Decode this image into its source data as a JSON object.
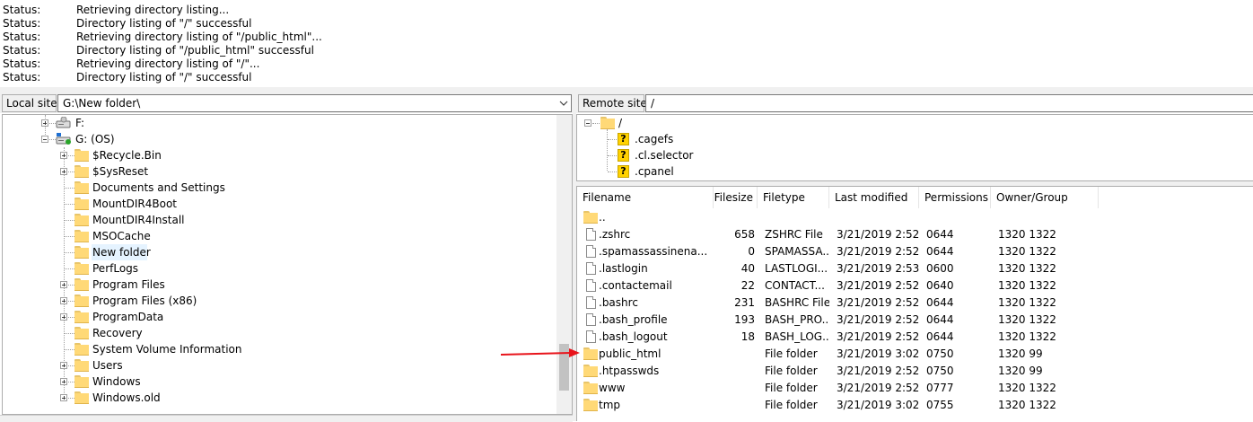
{
  "status_log": [
    {
      "label": "Status:",
      "message": "Retrieving directory listing..."
    },
    {
      "label": "Status:",
      "message": "Directory listing of \"/\" successful"
    },
    {
      "label": "Status:",
      "message": "Retrieving directory listing of \"/public_html\"..."
    },
    {
      "label": "Status:",
      "message": "Directory listing of \"/public_html\" successful"
    },
    {
      "label": "Status:",
      "message": "Retrieving directory listing of \"/\"..."
    },
    {
      "label": "Status:",
      "message": "Directory listing of \"/\" successful"
    }
  ],
  "local": {
    "site_label": "Local site:",
    "path": "G:\\New folder\\",
    "tree": [
      {
        "label": "F:",
        "type": "drive",
        "expander": "plus"
      },
      {
        "label": "G: (OS)",
        "type": "drive",
        "expander": "minus"
      },
      {
        "label": "$Recycle.Bin",
        "type": "folder",
        "expander": "plus"
      },
      {
        "label": "$SysReset",
        "type": "folder",
        "expander": "plus"
      },
      {
        "label": "Documents and Settings",
        "type": "folder",
        "expander": "none"
      },
      {
        "label": "MountDIR4Boot",
        "type": "folder",
        "expander": "none"
      },
      {
        "label": "MountDIR4Install",
        "type": "folder",
        "expander": "none"
      },
      {
        "label": "MSOCache",
        "type": "folder",
        "expander": "none"
      },
      {
        "label": "New folder",
        "type": "folder",
        "expander": "none",
        "selected": true
      },
      {
        "label": "PerfLogs",
        "type": "folder",
        "expander": "none"
      },
      {
        "label": "Program Files",
        "type": "folder",
        "expander": "plus"
      },
      {
        "label": "Program Files (x86)",
        "type": "folder",
        "expander": "plus"
      },
      {
        "label": "ProgramData",
        "type": "folder",
        "expander": "plus"
      },
      {
        "label": "Recovery",
        "type": "folder",
        "expander": "none"
      },
      {
        "label": "System Volume Information",
        "type": "folder",
        "expander": "none"
      },
      {
        "label": "Users",
        "type": "folder",
        "expander": "plus"
      },
      {
        "label": "Windows",
        "type": "folder",
        "expander": "plus"
      },
      {
        "label": "Windows.old",
        "type": "folder",
        "expander": "plus"
      }
    ]
  },
  "remote": {
    "site_label": "Remote site:",
    "path": "/",
    "tree": [
      {
        "label": "/",
        "type": "folder",
        "expander": "minus"
      },
      {
        "label": ".cagefs",
        "type": "unknown",
        "expander": "none"
      },
      {
        "label": ".cl.selector",
        "type": "unknown",
        "expander": "none"
      },
      {
        "label": ".cpanel",
        "type": "unknown",
        "expander": "none"
      }
    ],
    "columns": {
      "filename": "Filename",
      "filesize": "Filesize",
      "filetype": "Filetype",
      "modified": "Last modified",
      "permissions": "Permissions",
      "owner": "Owner/Group"
    },
    "files": [
      {
        "name": "..",
        "icon": "folder",
        "size": "",
        "type": "",
        "modified": "",
        "perms": "",
        "owner": ""
      },
      {
        "name": ".zshrc",
        "icon": "file",
        "size": "658",
        "type": "ZSHRC File",
        "modified": "3/21/2019 2:52:...",
        "perms": "0644",
        "owner": "1320 1322"
      },
      {
        "name": ".spamassassinena...",
        "icon": "file",
        "size": "0",
        "type": "SPAMASSA...",
        "modified": "3/21/2019 2:52:...",
        "perms": "0644",
        "owner": "1320 1322"
      },
      {
        "name": ".lastlogin",
        "icon": "file",
        "size": "40",
        "type": "LASTLOGI...",
        "modified": "3/21/2019 2:53:...",
        "perms": "0600",
        "owner": "1320 1322"
      },
      {
        "name": ".contactemail",
        "icon": "file",
        "size": "22",
        "type": "CONTACT...",
        "modified": "3/21/2019 2:52:...",
        "perms": "0640",
        "owner": "1320 1322"
      },
      {
        "name": ".bashrc",
        "icon": "file",
        "size": "231",
        "type": "BASHRC File",
        "modified": "3/21/2019 2:52:...",
        "perms": "0644",
        "owner": "1320 1322"
      },
      {
        "name": ".bash_profile",
        "icon": "file",
        "size": "193",
        "type": "BASH_PRO...",
        "modified": "3/21/2019 2:52:...",
        "perms": "0644",
        "owner": "1320 1322"
      },
      {
        "name": ".bash_logout",
        "icon": "file",
        "size": "18",
        "type": "BASH_LOG...",
        "modified": "3/21/2019 2:52:...",
        "perms": "0644",
        "owner": "1320 1322"
      },
      {
        "name": "public_html",
        "icon": "folder",
        "size": "",
        "type": "File folder",
        "modified": "3/21/2019 3:02:...",
        "perms": "0750",
        "owner": "1320 99"
      },
      {
        "name": ".htpasswds",
        "icon": "folder",
        "size": "",
        "type": "File folder",
        "modified": "3/21/2019 2:52:...",
        "perms": "0750",
        "owner": "1320 99"
      },
      {
        "name": "www",
        "icon": "link",
        "size": "",
        "type": "File folder",
        "modified": "3/21/2019 2:52:...",
        "perms": "0777",
        "owner": "1320 1322"
      },
      {
        "name": "tmp",
        "icon": "folder",
        "size": "",
        "type": "File folder",
        "modified": "3/21/2019 3:02:...",
        "perms": "0755",
        "owner": "1320 1322"
      }
    ]
  },
  "annotation_color": "#e8141b"
}
